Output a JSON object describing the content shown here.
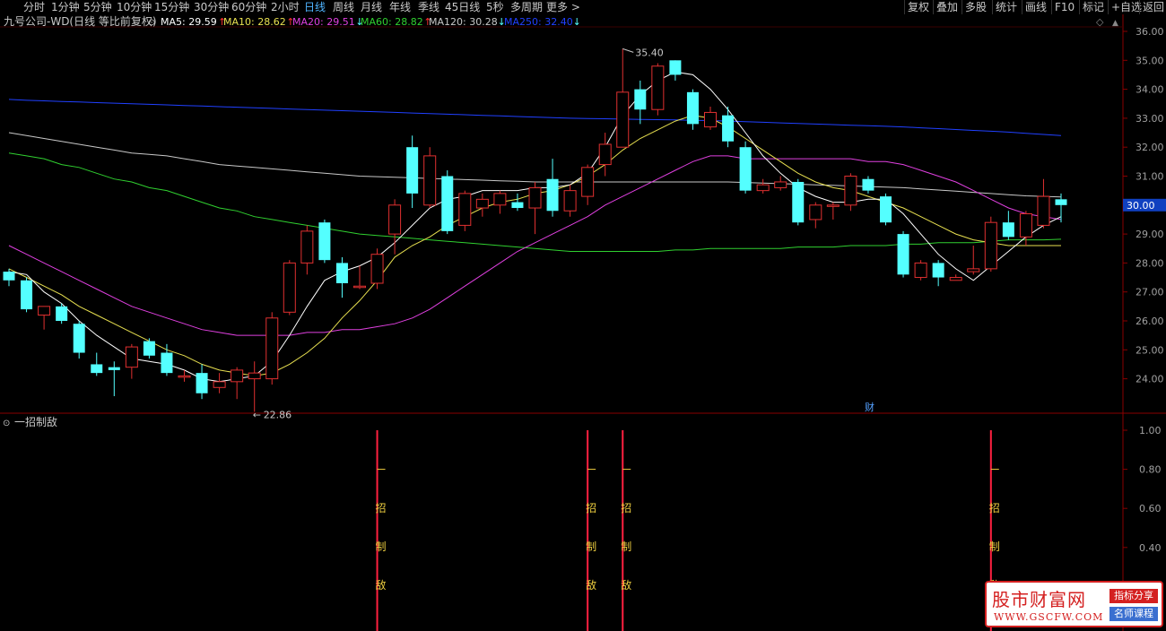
{
  "toolbar": {
    "periods": [
      "分时",
      "1分钟",
      "5分钟",
      "10分钟",
      "15分钟",
      "30分钟",
      "60分钟",
      "2小时",
      "日线",
      "周线",
      "月线",
      "年线",
      "季线",
      "45日线",
      "5秒",
      "多周期",
      "更多 >"
    ],
    "active_period": "日线",
    "right_buttons": [
      "复权",
      "叠加",
      "多股",
      "统计",
      "画线",
      "F10",
      "标记",
      "+自选",
      "返回"
    ]
  },
  "header": {
    "title": "九号公司-WD(日线 等比前复权)",
    "ma": [
      {
        "label": "MA5: 29.59",
        "arrow": "↑",
        "color": "#ffffff"
      },
      {
        "label": "MA10: 28.62",
        "arrow": "↑",
        "color": "#e8e050"
      },
      {
        "label": "MA20: 29.51",
        "arrow": "↓",
        "color": "#e040e0"
      },
      {
        "label": "MA60: 28.82",
        "arrow": "↑",
        "color": "#30d030"
      },
      {
        "label": "MA120: 30.28",
        "arrow": "↓",
        "color": "#c8c8c8"
      },
      {
        "label": "MA250: 32.40",
        "arrow": "↓",
        "color": "#2040ff"
      }
    ]
  },
  "colors": {
    "up": "#e03030",
    "down": "#54ffff",
    "ma5": "#ffffff",
    "ma10": "#e8e050",
    "ma20": "#e040e0",
    "ma60": "#30d030",
    "ma120": "#c8c8c8",
    "ma250": "#2040ff",
    "signal_line": "#ff2040",
    "signal_text": "#f0d040",
    "price_tag_bg": "#1040c0"
  },
  "chart_data": {
    "type": "candlestick",
    "ylim": [
      23.2,
      36.3
    ],
    "y_ticks": [
      "36.00",
      "35.00",
      "34.00",
      "33.00",
      "32.00",
      "31.00",
      "30.00",
      "29.00",
      "28.00",
      "27.00",
      "26.00",
      "25.00",
      "24.00"
    ],
    "current_price": "30.00",
    "high_marker": "35.40",
    "low_marker": "22.86",
    "event_marker": "财",
    "candles": [
      {
        "o": 27.7,
        "h": 27.8,
        "l": 27.2,
        "c": 27.4
      },
      {
        "o": 27.4,
        "h": 27.5,
        "l": 26.3,
        "c": 26.4
      },
      {
        "o": 26.2,
        "h": 26.5,
        "l": 25.7,
        "c": 26.5
      },
      {
        "o": 26.5,
        "h": 26.6,
        "l": 25.9,
        "c": 26.0
      },
      {
        "o": 25.9,
        "h": 26.0,
        "l": 24.7,
        "c": 24.9
      },
      {
        "o": 24.5,
        "h": 24.9,
        "l": 24.1,
        "c": 24.2
      },
      {
        "o": 24.4,
        "h": 24.6,
        "l": 23.4,
        "c": 24.3
      },
      {
        "o": 24.4,
        "h": 25.2,
        "l": 24.0,
        "c": 25.1
      },
      {
        "o": 25.3,
        "h": 25.4,
        "l": 24.7,
        "c": 24.8
      },
      {
        "o": 24.9,
        "h": 25.2,
        "l": 24.1,
        "c": 24.2
      },
      {
        "o": 24.1,
        "h": 24.3,
        "l": 23.9,
        "c": 24.1
      },
      {
        "o": 24.2,
        "h": 24.5,
        "l": 23.3,
        "c": 23.5
      },
      {
        "o": 23.7,
        "h": 24.2,
        "l": 23.5,
        "c": 23.9
      },
      {
        "o": 23.9,
        "h": 24.4,
        "l": 23.3,
        "c": 24.3
      },
      {
        "o": 24.0,
        "h": 24.6,
        "l": 22.86,
        "c": 24.2
      },
      {
        "o": 24.0,
        "h": 26.3,
        "l": 23.8,
        "c": 26.1
      },
      {
        "o": 26.3,
        "h": 28.1,
        "l": 26.2,
        "c": 28.0
      },
      {
        "o": 28.0,
        "h": 29.3,
        "l": 27.6,
        "c": 29.1
      },
      {
        "o": 29.4,
        "h": 29.5,
        "l": 28.0,
        "c": 28.1
      },
      {
        "o": 28.0,
        "h": 28.2,
        "l": 26.8,
        "c": 27.3
      },
      {
        "o": 27.2,
        "h": 27.9,
        "l": 27.1,
        "c": 27.2
      },
      {
        "o": 27.3,
        "h": 28.5,
        "l": 27.1,
        "c": 28.3
      },
      {
        "o": 29.0,
        "h": 30.2,
        "l": 28.3,
        "c": 30.0
      },
      {
        "o": 32.0,
        "h": 32.4,
        "l": 29.9,
        "c": 30.4
      },
      {
        "o": 30.0,
        "h": 32.0,
        "l": 29.9,
        "c": 31.7
      },
      {
        "o": 31.0,
        "h": 31.2,
        "l": 29.0,
        "c": 29.1
      },
      {
        "o": 29.3,
        "h": 30.5,
        "l": 29.1,
        "c": 30.4
      },
      {
        "o": 29.9,
        "h": 30.4,
        "l": 29.6,
        "c": 30.2
      },
      {
        "o": 30.0,
        "h": 30.5,
        "l": 29.7,
        "c": 30.4
      },
      {
        "o": 30.1,
        "h": 30.4,
        "l": 29.8,
        "c": 29.9
      },
      {
        "o": 29.9,
        "h": 30.8,
        "l": 29.0,
        "c": 30.6
      },
      {
        "o": 30.9,
        "h": 31.6,
        "l": 29.6,
        "c": 29.8
      },
      {
        "o": 29.8,
        "h": 30.7,
        "l": 29.6,
        "c": 30.5
      },
      {
        "o": 30.3,
        "h": 31.4,
        "l": 30.0,
        "c": 31.3
      },
      {
        "o": 31.4,
        "h": 32.5,
        "l": 31.0,
        "c": 32.1
      },
      {
        "o": 32.0,
        "h": 35.4,
        "l": 32.0,
        "c": 33.9
      },
      {
        "o": 34.0,
        "h": 34.3,
        "l": 32.8,
        "c": 33.3
      },
      {
        "o": 33.3,
        "h": 34.9,
        "l": 33.1,
        "c": 34.8
      },
      {
        "o": 35.0,
        "h": 35.0,
        "l": 34.3,
        "c": 34.5
      },
      {
        "o": 33.9,
        "h": 34.0,
        "l": 32.6,
        "c": 32.8
      },
      {
        "o": 32.7,
        "h": 33.4,
        "l": 32.6,
        "c": 33.2
      },
      {
        "o": 33.1,
        "h": 33.4,
        "l": 32.0,
        "c": 32.2
      },
      {
        "o": 32.0,
        "h": 32.2,
        "l": 30.4,
        "c": 30.5
      },
      {
        "o": 30.5,
        "h": 30.9,
        "l": 30.4,
        "c": 30.7
      },
      {
        "o": 30.6,
        "h": 31.0,
        "l": 30.5,
        "c": 30.8
      },
      {
        "o": 30.8,
        "h": 30.9,
        "l": 29.3,
        "c": 29.4
      },
      {
        "o": 29.5,
        "h": 30.1,
        "l": 29.2,
        "c": 30.0
      },
      {
        "o": 30.0,
        "h": 30.1,
        "l": 29.5,
        "c": 30.0
      },
      {
        "o": 30.0,
        "h": 31.1,
        "l": 29.8,
        "c": 31.0
      },
      {
        "o": 30.9,
        "h": 31.0,
        "l": 30.4,
        "c": 30.5
      },
      {
        "o": 30.3,
        "h": 30.4,
        "l": 29.3,
        "c": 29.4
      },
      {
        "o": 29.0,
        "h": 29.1,
        "l": 27.5,
        "c": 27.6
      },
      {
        "o": 27.5,
        "h": 28.1,
        "l": 27.4,
        "c": 28.0
      },
      {
        "o": 28.0,
        "h": 28.1,
        "l": 27.2,
        "c": 27.5
      },
      {
        "o": 27.4,
        "h": 27.6,
        "l": 27.4,
        "c": 27.5
      },
      {
        "o": 27.7,
        "h": 28.6,
        "l": 27.6,
        "c": 27.8
      },
      {
        "o": 27.8,
        "h": 29.6,
        "l": 27.7,
        "c": 29.4
      },
      {
        "o": 29.4,
        "h": 29.8,
        "l": 28.8,
        "c": 28.9
      },
      {
        "o": 28.9,
        "h": 29.8,
        "l": 28.6,
        "c": 29.7
      },
      {
        "o": 29.3,
        "h": 30.9,
        "l": 29.2,
        "c": 30.3
      },
      {
        "o": 30.2,
        "h": 30.4,
        "l": 29.4,
        "c": 30.0
      }
    ],
    "ma_series": {
      "ma5": [
        27.7,
        27.6,
        27.0,
        26.6,
        26.0,
        25.5,
        25.1,
        24.7,
        24.6,
        24.5,
        24.3,
        24.0,
        23.9,
        24.0,
        24.1,
        24.6,
        25.5,
        26.5,
        27.4,
        27.7,
        27.9,
        28.2,
        28.7,
        29.3,
        29.9,
        30.2,
        30.3,
        30.5,
        30.5,
        30.5,
        30.6,
        30.6,
        30.7,
        31.1,
        32.0,
        33.1,
        33.8,
        34.3,
        34.6,
        34.5,
        34.0,
        33.3,
        32.5,
        31.7,
        31.1,
        30.6,
        30.3,
        30.1,
        30.1,
        30.2,
        30.2,
        29.7,
        29.0,
        28.3,
        27.8,
        27.4,
        27.9,
        28.4,
        28.9,
        29.3,
        29.6
      ],
      "ma10": [
        27.8,
        27.5,
        27.2,
        26.9,
        26.5,
        26.2,
        25.9,
        25.6,
        25.3,
        25.0,
        24.8,
        24.5,
        24.3,
        24.2,
        24.1,
        24.2,
        24.5,
        24.9,
        25.4,
        26.1,
        26.7,
        27.4,
        28.2,
        28.6,
        28.9,
        29.3,
        29.6,
        29.9,
        30.1,
        30.2,
        30.4,
        30.5,
        30.7,
        31.0,
        31.4,
        31.9,
        32.3,
        32.6,
        32.9,
        33.1,
        33.0,
        32.7,
        32.3,
        31.9,
        31.5,
        31.1,
        30.8,
        30.6,
        30.5,
        30.3,
        30.1,
        29.9,
        29.6,
        29.3,
        29.0,
        28.8,
        28.7,
        28.6,
        28.6,
        28.6,
        28.6
      ],
      "ma20": [
        28.6,
        28.3,
        28.0,
        27.7,
        27.4,
        27.1,
        26.8,
        26.5,
        26.3,
        26.1,
        25.9,
        25.7,
        25.6,
        25.5,
        25.5,
        25.5,
        25.5,
        25.6,
        25.6,
        25.7,
        25.7,
        25.8,
        25.9,
        26.1,
        26.4,
        26.8,
        27.2,
        27.6,
        28.0,
        28.4,
        28.7,
        29.0,
        29.3,
        29.6,
        30.0,
        30.3,
        30.6,
        30.9,
        31.2,
        31.5,
        31.7,
        31.7,
        31.6,
        31.6,
        31.6,
        31.6,
        31.6,
        31.6,
        31.6,
        31.5,
        31.5,
        31.4,
        31.2,
        31.0,
        30.8,
        30.5,
        30.2,
        29.9,
        29.7,
        29.6,
        29.5
      ],
      "ma60": [
        31.8,
        31.7,
        31.6,
        31.4,
        31.3,
        31.1,
        30.9,
        30.8,
        30.6,
        30.5,
        30.3,
        30.1,
        29.9,
        29.8,
        29.6,
        29.5,
        29.4,
        29.3,
        29.2,
        29.1,
        29.0,
        28.95,
        28.9,
        28.85,
        28.8,
        28.75,
        28.7,
        28.65,
        28.6,
        28.55,
        28.5,
        28.45,
        28.4,
        28.4,
        28.4,
        28.4,
        28.4,
        28.4,
        28.45,
        28.45,
        28.5,
        28.5,
        28.5,
        28.5,
        28.5,
        28.55,
        28.55,
        28.55,
        28.6,
        28.6,
        28.6,
        28.65,
        28.65,
        28.7,
        28.7,
        28.7,
        28.75,
        28.8,
        28.8,
        28.8,
        28.82
      ],
      "ma120": [
        32.5,
        32.4,
        32.3,
        32.2,
        32.1,
        32.0,
        31.9,
        31.8,
        31.75,
        31.7,
        31.6,
        31.5,
        31.4,
        31.35,
        31.3,
        31.25,
        31.2,
        31.15,
        31.1,
        31.05,
        31.0,
        30.98,
        30.96,
        30.94,
        30.92,
        30.9,
        30.88,
        30.86,
        30.84,
        30.82,
        30.8,
        30.8,
        30.8,
        30.8,
        30.8,
        30.8,
        30.8,
        30.8,
        30.8,
        30.8,
        30.8,
        30.8,
        30.78,
        30.76,
        30.74,
        30.72,
        30.7,
        30.68,
        30.66,
        30.64,
        30.62,
        30.6,
        30.56,
        30.52,
        30.48,
        30.44,
        30.4,
        30.36,
        30.32,
        30.3,
        30.28
      ],
      "ma250": [
        33.65,
        33.62,
        33.6,
        33.58,
        33.56,
        33.54,
        33.52,
        33.5,
        33.48,
        33.46,
        33.44,
        33.42,
        33.4,
        33.38,
        33.36,
        33.34,
        33.32,
        33.3,
        33.28,
        33.26,
        33.24,
        33.22,
        33.2,
        33.18,
        33.16,
        33.14,
        33.12,
        33.1,
        33.08,
        33.06,
        33.04,
        33.02,
        33.0,
        32.99,
        32.98,
        32.97,
        32.96,
        32.95,
        32.94,
        32.93,
        32.92,
        32.9,
        32.88,
        32.86,
        32.84,
        32.82,
        32.8,
        32.78,
        32.76,
        32.74,
        32.72,
        32.7,
        32.67,
        32.64,
        32.61,
        32.58,
        32.55,
        32.52,
        32.48,
        32.44,
        32.4
      ]
    },
    "indicator": {
      "name": "一招制敌",
      "ylim": [
        0,
        1.05
      ],
      "y_ticks": [
        "1.00",
        "0.80",
        "0.60",
        "0.40"
      ],
      "signal_candles": [
        21,
        33,
        35,
        56
      ],
      "signal_chars": [
        "招",
        "制",
        "敌"
      ]
    }
  },
  "watermark": {
    "main": "股市财富网",
    "url": "WWW.GSCFW.COM",
    "tag1": "指标分享",
    "tag2": "名师课程"
  }
}
